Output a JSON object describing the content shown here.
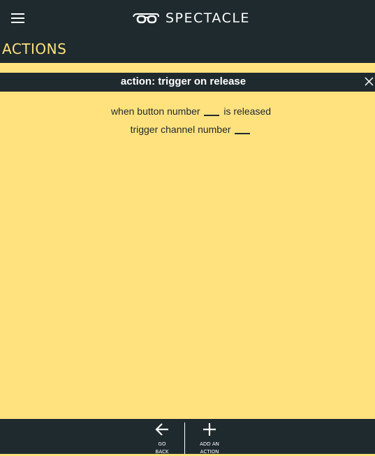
{
  "header": {
    "brand": "SPECTACLE",
    "menu_icon": "hamburger-icon",
    "logo_icon": "glasses-icon"
  },
  "section": {
    "title": "ACTIONS"
  },
  "action": {
    "title": "action: trigger on release",
    "close_icon": "close-icon",
    "line1_before": "when button number",
    "line1_after": "is released",
    "line2_before": "trigger channel number"
  },
  "footer": {
    "back_label_1": "GO",
    "back_label_2": "BACK",
    "add_label_1": "ADD AN",
    "add_label_2": "ACTION",
    "back_icon": "arrow-left-icon",
    "add_icon": "plus-icon"
  },
  "colors": {
    "accent": "#ffe27e",
    "dark": "#1f2a2e",
    "text_light": "#ffffff"
  }
}
